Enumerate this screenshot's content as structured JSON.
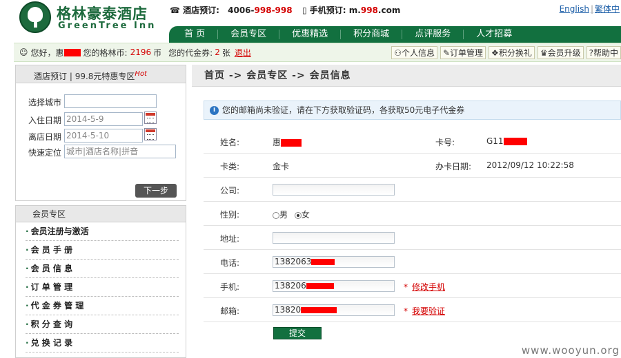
{
  "header": {
    "brand_cn": "格林豪泰酒店",
    "brand_en": "GreenTree Inn",
    "hotel_phone_label": "酒店预订:",
    "hotel_phone_prefix": "4006-",
    "hotel_phone_suffix": "998-998",
    "mobile_label": "手机预订:",
    "mobile_prefix": "m.",
    "mobile_mid": "998",
    "mobile_suffix": ".com",
    "lang_en": "English",
    "lang_sep": "|",
    "lang_zh": "繁体中"
  },
  "nav": {
    "items": [
      "首 页",
      "会员专区",
      "优惠精选",
      "积分商城",
      "点评服务",
      "人才招募"
    ]
  },
  "greeting": {
    "hello": "您好，惠",
    "coins_label": "您的格林币:",
    "coins_value": "2196",
    "coins_unit": "币",
    "vouchers_label": "您的代金券:",
    "vouchers_value": "2",
    "vouchers_unit": "张",
    "logout": "退出",
    "quick_links": [
      "个人信息",
      "订单管理",
      "积分换礼",
      "会员升级",
      "帮助中"
    ]
  },
  "booking": {
    "title": "酒店预订",
    "promo": "99.8元特惠专区",
    "hot": "Hot",
    "city_label": "选择城市",
    "checkin_label": "入住日期",
    "checkin_value": "2014-5-9",
    "checkout_label": "离店日期",
    "checkout_value": "2014-5-10",
    "locate_label": "快速定位",
    "locate_placeholder": "城市|酒店名称|拼音",
    "next": "下一步"
  },
  "member_menu": {
    "title": "会员专区",
    "items": [
      "会员注册与激活",
      "会 员 手 册",
      "会 员 信 息",
      "订 单 管 理",
      "代 金 券 管 理",
      "积 分 查 询",
      "兑 换 记 录"
    ]
  },
  "main": {
    "breadcrumb": "首页 -> 会员专区 -> 会员信息",
    "notice": "您的邮箱尚未验证，请在下方获取验证码，各获取50元电子代金券",
    "name_label": "姓名:",
    "name_value": "惠",
    "card_label": "卡号:",
    "card_value": "G11",
    "card_type_label": "卡类:",
    "card_type_value": "金卡",
    "issue_date_label": "办卡日期:",
    "issue_date_value": "2012/09/12 10:22:58",
    "company_label": "公司:",
    "gender_label": "性别:",
    "gender_male": "男",
    "gender_female": "女",
    "address_label": "地址:",
    "phone_label": "电话:",
    "phone_value": "1382063",
    "mobile_label": "手机:",
    "mobile_value": "138206",
    "mobile_link": "修改手机",
    "email_label": "邮箱:",
    "email_value": "13820",
    "email_link": "我要验证",
    "asterisk": "*",
    "submit": "提交"
  },
  "watermark": "www.wooyun.org"
}
